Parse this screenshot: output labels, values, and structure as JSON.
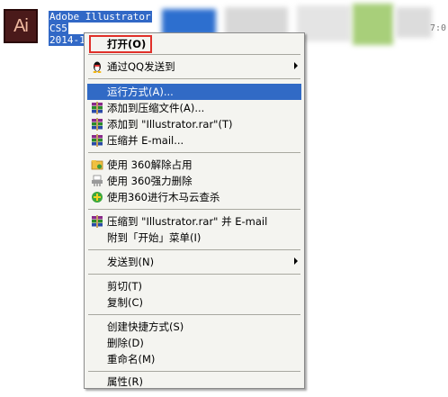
{
  "desktop": {
    "file": {
      "icon_text": "Ai",
      "lines": [
        "Adobe Illustrator",
        "CS5",
        "2014-1"
      ]
    },
    "edge_text": "7:0"
  },
  "menu": {
    "open": "打开(O)",
    "qq": "通过QQ发送到",
    "run_as": "运行方式(A)...",
    "add_archive": "添加到压缩文件(A)...",
    "add_rar": "添加到 \"Illustrator.rar\"(T)",
    "compress_email": "压缩并 E-mail...",
    "unlock_360": "使用 360解除占用",
    "delete_360": "使用 360强力删除",
    "scan_360": "使用360进行木马云查杀",
    "compress_rar_email": "压缩到 \"Illustrator.rar\" 并 E-mail",
    "pin_start": "附到「开始」菜单(I)",
    "send_to": "发送到(N)",
    "cut": "剪切(T)",
    "copy": "复制(C)",
    "create_shortcut": "创建快捷方式(S)",
    "delete": "删除(D)",
    "rename": "重命名(M)",
    "properties": "属性(R)"
  },
  "colors": {
    "highlight": "#316ac5",
    "open_outline": "#e0302a",
    "menu_bg": "#f4f4f0"
  }
}
